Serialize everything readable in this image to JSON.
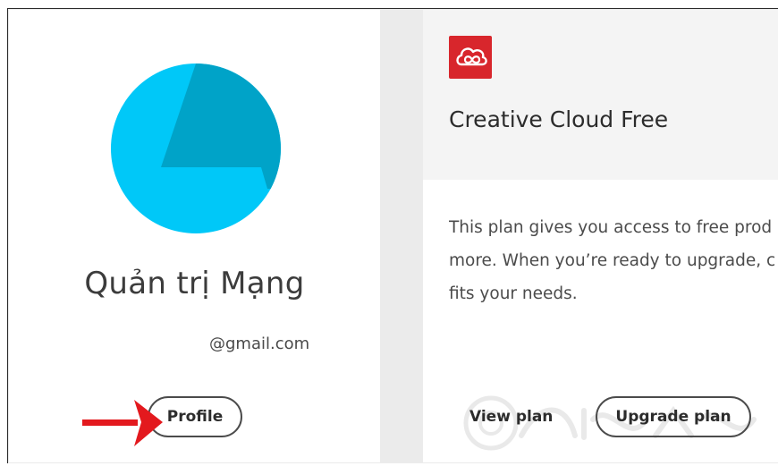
{
  "profile": {
    "name": "Quản trị Mạng",
    "email": "@gmail.com",
    "profile_button_label": "Profile"
  },
  "plan": {
    "title": "Creative Cloud Free",
    "description_lines": [
      "This plan gives you access to free prod",
      "more. When you’re ready to upgrade, c",
      "fits your needs."
    ],
    "view_plan_label": "View plan",
    "upgrade_plan_label": "Upgrade plan"
  },
  "icons": {
    "avatar": "geometric-avatar-icon",
    "logo": "creative-cloud-logo-icon",
    "annotation": "red-arrow-icon"
  },
  "colors": {
    "avatar_light": "#00c8f8",
    "avatar_dark": "#00a3c8",
    "cc_red": "#d8262c",
    "arrow_red": "#e3191e"
  }
}
